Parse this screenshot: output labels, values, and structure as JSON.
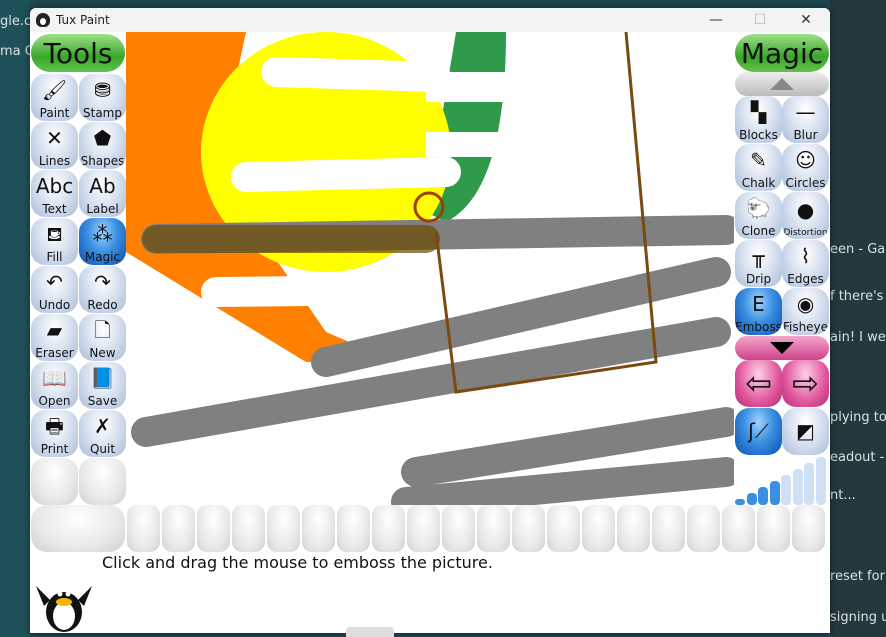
{
  "window": {
    "title": "Tux Paint",
    "minimize": "—",
    "maximize": "☐",
    "close": "✕"
  },
  "background": {
    "left": [
      "gle.co",
      "ma G"
    ],
    "right": [
      "een - Gar",
      "f there's a",
      "ain! I wer",
      "plying to",
      "eadout - ",
      "nt...",
      "reset for t",
      "signing u"
    ]
  },
  "tools": {
    "header": "Tools",
    "items": [
      {
        "label": "Paint",
        "icon": "brush-icon",
        "glyph": "🖌"
      },
      {
        "label": "Stamp",
        "icon": "stamp-icon",
        "glyph": "⛃"
      },
      {
        "label": "Lines",
        "icon": "lines-icon",
        "glyph": "✕"
      },
      {
        "label": "Shapes",
        "icon": "pentagon-icon",
        "glyph": "⬟"
      },
      {
        "label": "Text",
        "icon": "text-icon",
        "glyph": "Abc"
      },
      {
        "label": "Label",
        "icon": "label-icon",
        "glyph": "Ab"
      },
      {
        "label": "Fill",
        "icon": "bucket-icon",
        "glyph": "⛾"
      },
      {
        "label": "Magic",
        "icon": "magic-wand-icon",
        "glyph": "⁂",
        "selected": true
      },
      {
        "label": "Undo",
        "icon": "undo-icon",
        "glyph": "↶"
      },
      {
        "label": "Redo",
        "icon": "redo-icon",
        "glyph": "↷"
      },
      {
        "label": "Eraser",
        "icon": "eraser-icon",
        "glyph": "▰"
      },
      {
        "label": "New",
        "icon": "new-page-icon",
        "glyph": "🗋"
      },
      {
        "label": "Open",
        "icon": "open-book-icon",
        "glyph": "📖"
      },
      {
        "label": "Save",
        "icon": "save-book-icon",
        "glyph": "📘"
      },
      {
        "label": "Print",
        "icon": "printer-icon",
        "glyph": "🖶"
      },
      {
        "label": "Quit",
        "icon": "quit-icon",
        "glyph": "✗"
      }
    ]
  },
  "magic": {
    "header": "Magic",
    "items": [
      {
        "label": "Blocks",
        "icon": "blocks-icon",
        "glyph": "▚"
      },
      {
        "label": "Blur",
        "icon": "blur-icon",
        "glyph": "—"
      },
      {
        "label": "Chalk",
        "icon": "chalk-icon",
        "glyph": "✎"
      },
      {
        "label": "Circles",
        "icon": "circles-icon",
        "glyph": "☺"
      },
      {
        "label": "Clone",
        "icon": "clone-icon",
        "glyph": "🐑"
      },
      {
        "label": "Distortion",
        "icon": "distortion-icon",
        "glyph": "●"
      },
      {
        "label": "Drip",
        "icon": "drip-icon",
        "glyph": "╥"
      },
      {
        "label": "Edges",
        "icon": "edges-icon",
        "glyph": "⌇"
      },
      {
        "label": "Emboss",
        "icon": "emboss-icon",
        "glyph": "E",
        "selected": true
      },
      {
        "label": "Fisheye",
        "icon": "fisheye-icon",
        "glyph": "◉"
      }
    ],
    "mode_paint": "paint-mode-icon",
    "mode_fullscreen": "fullscreen-mode-icon"
  },
  "instruction": "Click and drag the mouse to emboss the picture.",
  "colors": {
    "accent_green": "#3aa52a",
    "selected_blue": "#0b4fb5",
    "pink": "#e0579e",
    "orange": "#ff7f00",
    "yellow": "#ffff00",
    "green": "#2e9a4a",
    "gray": "#808080"
  }
}
